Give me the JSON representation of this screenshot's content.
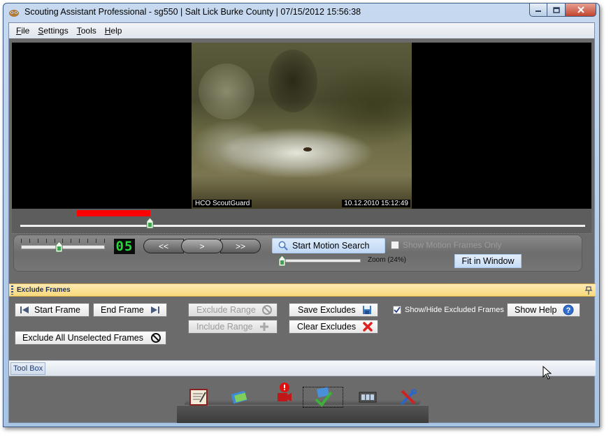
{
  "window": {
    "title": "Scouting Assistant Professional - sg550 | Salt Lick Burke County | 07/15/2012 15:56:38",
    "caption_buttons": {
      "minimize": "minimize-icon",
      "maximize": "maximize-icon",
      "close": "close-icon"
    }
  },
  "menu": {
    "items": [
      {
        "label": "File",
        "mnemonic": "F",
        "rest": "ile"
      },
      {
        "label": "Settings",
        "mnemonic": "S",
        "rest": "ettings"
      },
      {
        "label": "Tools",
        "mnemonic": "T",
        "rest": "ools"
      },
      {
        "label": "Help",
        "mnemonic": "H",
        "rest": "elp"
      }
    ]
  },
  "video": {
    "camera_label": "HCO ScoutGuard",
    "timestamp": "10.12.2010 15:12:49"
  },
  "timeline": {
    "position_fraction": 0.23,
    "marker_color": "#ff0000"
  },
  "player": {
    "speed_fraction": 0.45,
    "frame_counter": "05",
    "rewind_label": "<<",
    "play_label": ">",
    "forward_label": ">>",
    "motion_search_label": "Start Motion Search",
    "motion_only_label": "Show Motion Frames Only",
    "motion_only_checked": false,
    "zoom_label": "Zoom (24%)",
    "zoom_fraction": 0.0,
    "fit_label": "Fit in Window"
  },
  "exclude": {
    "panel_title": "Exclude Frames",
    "start_frame": "Start Frame",
    "end_frame": "End Frame",
    "exclude_range": "Exclude Range",
    "include_range": "Include Range",
    "save_excludes": "Save Excludes",
    "clear_excludes": "Clear Excludes",
    "exclude_all": "Exclude All Unselected Frames",
    "show_hide_label": "Show/Hide Excluded Frames",
    "show_hide_checked": true,
    "show_help": "Show Help"
  },
  "toolbox": {
    "tab_label": "Tool Box",
    "icons": [
      "report-icon",
      "photos-icon",
      "record-alert-icon",
      "verify-photo-icon",
      "film-strip-icon",
      "tools-icon"
    ],
    "selected_index": 3
  },
  "colors": {
    "panel_gray": "#6b6b6b",
    "accent_yellow": "#f8d97a",
    "lcd_green": "#28d63a",
    "button_blue": "#c0d8f5"
  }
}
